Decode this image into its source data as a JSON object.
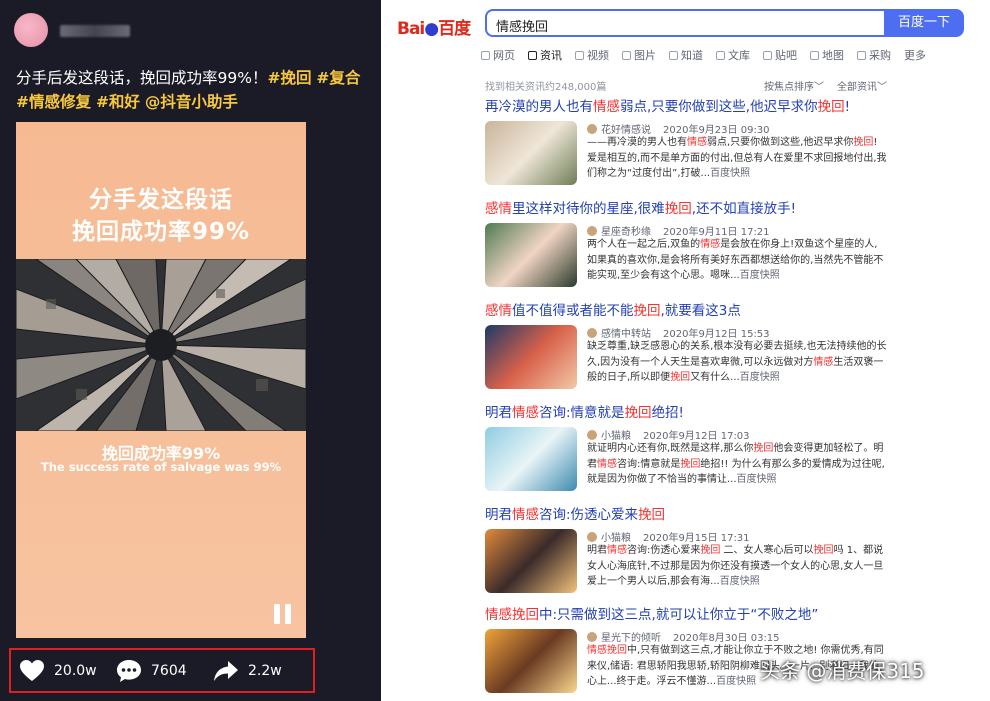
{
  "left": {
    "caption_text": "分手后发这段话，挽回成功率99%！",
    "tags": [
      "#挽回",
      "#复合",
      "#情感修复",
      "#和好",
      "@抖音小助手"
    ],
    "card": {
      "headline_line1": "分手发这段话",
      "headline_line2": "挽回成功率99%",
      "sub_cn": "挽回成功率99%",
      "sub_en": "The success rate of salvage was 99%"
    },
    "actions": {
      "likes": "20.0w",
      "comments": "7604",
      "shares": "2.2w"
    },
    "icons": [
      "heart-icon",
      "comment-icon",
      "share-icon",
      "pause-icon"
    ]
  },
  "right": {
    "logo_text_bai": "Bai",
    "logo_text_du": "百度",
    "search": {
      "value": "情感挽回",
      "button": "百度一下"
    },
    "tabs": [
      {
        "label": "网页",
        "icon": "web-icon"
      },
      {
        "label": "资讯",
        "icon": "news-icon",
        "active": true
      },
      {
        "label": "视频",
        "icon": "video-icon"
      },
      {
        "label": "图片",
        "icon": "image-icon"
      },
      {
        "label": "知道",
        "icon": "question-icon"
      },
      {
        "label": "文库",
        "icon": "doc-icon"
      },
      {
        "label": "贴吧",
        "icon": "tieba-icon"
      },
      {
        "label": "地图",
        "icon": "map-icon"
      },
      {
        "label": "采购",
        "icon": "purchase-icon"
      },
      {
        "label": "更多",
        "icon": ""
      }
    ],
    "result_count": "找到相关资讯约248,000篇",
    "sort": "按焦点排序",
    "filter": "全部资讯",
    "results": [
      {
        "title_parts": [
          [
            "再冷漠的男人也有",
            false
          ],
          [
            "情感",
            true
          ],
          [
            "弱点,只要你做到这些,他迟早求你",
            false
          ],
          [
            "挽回",
            true
          ],
          [
            "!",
            false
          ]
        ],
        "source": "花好情感说",
        "date": "2020年9月23日 09:30",
        "abstract_parts": [
          [
            "——再冷漠的男人也有",
            false
          ],
          [
            "情感",
            true
          ],
          [
            "弱点,只要你做到这些,他迟早求你",
            false
          ],
          [
            "挽回",
            true
          ],
          [
            "! 爱是相互的,而不是单方面的付出,但总有人在爱里不求回报地付出,我们称之为“过度付出”,打破...",
            false
          ]
        ],
        "snapshot": "百度快照",
        "thumb_colors": [
          "#c9b49a",
          "#efe6d8",
          "#6f7d56"
        ]
      },
      {
        "title_parts": [
          [
            "感情",
            true
          ],
          [
            "里这样对待你的星座,很难",
            false
          ],
          [
            "挽回",
            true
          ],
          [
            ",还不如直接放手!",
            false
          ]
        ],
        "source": "星座奇秒缘",
        "date": "2020年9月11日 17:21",
        "abstract_parts": [
          [
            "两个人在一起之后,双鱼的",
            false
          ],
          [
            "情感",
            true
          ],
          [
            "是会放在你身上!双鱼这个星座的人,如果真的喜欢你,是会将所有美好东西都想送给你的,当然先不管能不能实现,至少会有这个心思。嗯咪...",
            false
          ]
        ],
        "snapshot": "百度快照",
        "thumb_colors": [
          "#4f7a52",
          "#f1d5c4",
          "#2b3a2a"
        ]
      },
      {
        "title_parts": [
          [
            "感情",
            true
          ],
          [
            "值不值得或者能不能",
            false
          ],
          [
            "挽回",
            true
          ],
          [
            ",就要看这3点",
            false
          ]
        ],
        "source": "感情中转站",
        "date": "2020年9月12日 15:53",
        "abstract_parts": [
          [
            "缺乏尊重,缺乏感恩心的关系,根本没有必要去挺续,也无法持续他的长久,因为没有一个人天生是喜欢卑微,可以永远做对方",
            false
          ],
          [
            "情感",
            true
          ],
          [
            "生活双褒一般的日子,所以即便",
            false
          ],
          [
            "挽回",
            true
          ],
          [
            "又有什么...",
            false
          ]
        ],
        "snapshot": "百度快照",
        "thumb_colors": [
          "#1d3a66",
          "#d8614a",
          "#f2c9a8"
        ]
      },
      {
        "title_parts": [
          [
            "明君",
            false
          ],
          [
            "情感",
            true
          ],
          [
            "咨询:情意就是",
            false
          ],
          [
            "挽回",
            true
          ],
          [
            "绝招!",
            false
          ]
        ],
        "source": "小猫粮",
        "date": "2020年9月12日 17:03",
        "abstract_parts": [
          [
            "就证明内心还有你,既然是这样,那么你",
            false
          ],
          [
            "挽回",
            true
          ],
          [
            "他会变得更加轻松了。明君",
            false
          ],
          [
            "情感",
            true
          ],
          [
            "咨询:情意就是",
            false
          ],
          [
            "挽回",
            true
          ],
          [
            "绝招!! 为什么有那么多的爱情成为过往呢,就是因为你做了不恰当的事情让...",
            false
          ]
        ],
        "snapshot": "百度快照",
        "thumb_colors": [
          "#8ecde2",
          "#e9f4f6",
          "#3d8bb0"
        ]
      },
      {
        "title_parts": [
          [
            "明君",
            false
          ],
          [
            "情感",
            true
          ],
          [
            "咨询:伤透心爱来",
            false
          ],
          [
            "挽回",
            true
          ]
        ],
        "source": "小猫粮",
        "date": "2020年9月15日 17:31",
        "abstract_parts": [
          [
            "明君",
            false
          ],
          [
            "情感",
            true
          ],
          [
            "咨询:伤透心爱来",
            false
          ],
          [
            "挽回",
            true
          ],
          [
            " 二、女人寒心后可以",
            false
          ],
          [
            "挽回",
            true
          ],
          [
            "吗 1、都说女人心海底针,不过那是因为你还没有摸透一个女人的心思,女人一旦爱上一个男人以后,那会有海...",
            false
          ]
        ],
        "snapshot": "百度快照",
        "thumb_colors": [
          "#e28a3c",
          "#3a2a2a",
          "#f3c27a"
        ]
      },
      {
        "title_parts": [
          [
            "情感挽回",
            true
          ],
          [
            "中:只需做到这三点,就可以让你立于“不败之地”",
            false
          ]
        ],
        "source": "星光下的倾听",
        "date": "2020年8月30日 03:15",
        "abstract_parts": [
          [
            "情感挽回",
            true
          ],
          [
            "中,只有做到这三点,才能让你立于不败之地! 你需优秀,有同来仪,储语: 君思轿阳我思轿,轿阳阴柳难回头。一片...别老旧...我的心上...终于走。浮云不懂游...",
            false
          ]
        ],
        "snapshot": "百度快照",
        "thumb_colors": [
          "#f0a33c",
          "#6a3a22",
          "#fbd78e"
        ]
      }
    ]
  },
  "watermark": "头条 @消费保315"
}
